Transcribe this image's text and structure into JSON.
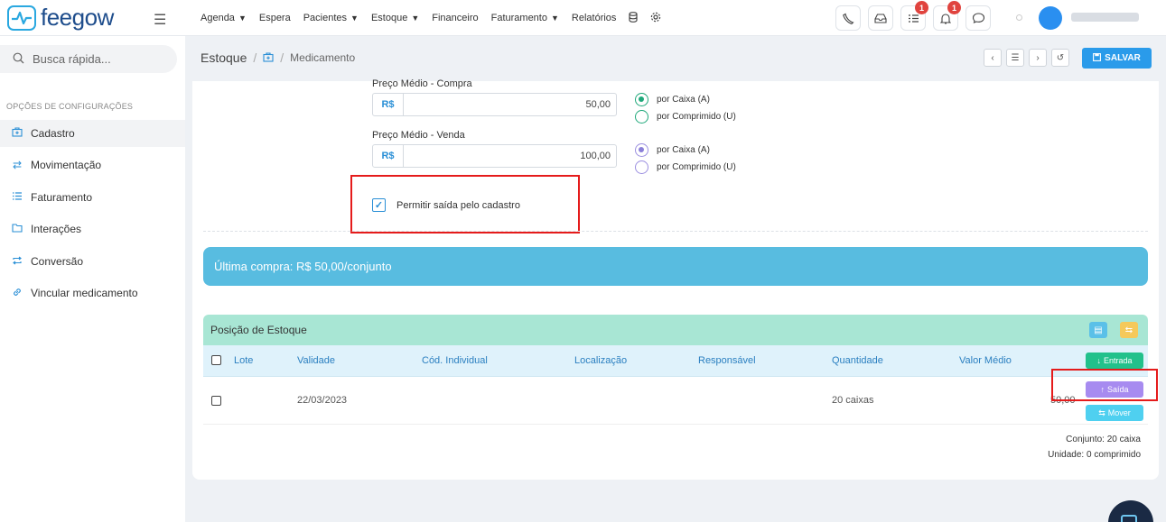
{
  "logo": {
    "text": "feegow"
  },
  "nav": {
    "items": [
      {
        "label": "Agenda",
        "dropdown": true
      },
      {
        "label": "Espera",
        "dropdown": false
      },
      {
        "label": "Pacientes",
        "dropdown": true
      },
      {
        "label": "Estoque",
        "dropdown": true
      },
      {
        "label": "Financeiro",
        "dropdown": false
      },
      {
        "label": "Faturamento",
        "dropdown": true
      },
      {
        "label": "Relatórios",
        "dropdown": false
      }
    ],
    "badges": {
      "tasks": "1",
      "notifications": "1"
    }
  },
  "sidebar": {
    "search_placeholder": "Busca rápida...",
    "section_title": "OPÇÕES DE CONFIGURAÇÕES",
    "items": [
      {
        "label": "Cadastro",
        "icon": "medkit-icon",
        "active": true
      },
      {
        "label": "Movimentação",
        "icon": "arrows-swap-icon",
        "active": false
      },
      {
        "label": "Faturamento",
        "icon": "list-icon",
        "active": false
      },
      {
        "label": "Interações",
        "icon": "folder-icon",
        "active": false
      },
      {
        "label": "Conversão",
        "icon": "repeat-icon",
        "active": false
      },
      {
        "label": "Vincular medicamento",
        "icon": "link-icon",
        "active": false
      }
    ]
  },
  "header": {
    "breadcrumb_root": "Estoque",
    "breadcrumb_sep": "/",
    "breadcrumb_sub": "Medicamento",
    "save_label": "SALVAR"
  },
  "form": {
    "compra": {
      "label": "Preço Médio - Compra",
      "prefix": "R$",
      "value": "50,00",
      "radio_a": "por Caixa (A)",
      "radio_u": "por Comprimido (U)",
      "selected": "A"
    },
    "venda": {
      "label": "Preço Médio - Venda",
      "prefix": "R$",
      "value": "100,00",
      "radio_a": "por Caixa (A)",
      "radio_u": "por Comprimido (U)",
      "selected": "A"
    },
    "permitir_saida": {
      "label": "Permitir saída pelo cadastro",
      "checked": true
    }
  },
  "alert": {
    "text": "Última compra: R$ 50,00/conjunto"
  },
  "stock": {
    "title": "Posição de Estoque",
    "columns": [
      "Lote",
      "Validade",
      "Cód. Individual",
      "Localização",
      "Responsável",
      "Quantidade",
      "Valor Médio"
    ],
    "rows": [
      {
        "lote": "",
        "validade": "22/03/2023",
        "cod": "",
        "localizacao": "",
        "responsavel": "",
        "quantidade": "20 caixas",
        "valor_medio": "50,00"
      }
    ],
    "actions": {
      "entrada": "Entrada",
      "saida": "Saída",
      "mover": "Mover"
    },
    "summary_conjunto": "Conjunto: 20 caixa",
    "summary_unidade": "Unidade: 0 comprimido"
  },
  "colors": {
    "brand_blue": "#2a9bea",
    "entrada_green": "#22c18b",
    "saida_purple": "#a78bf0",
    "mover_cyan": "#4fd0f0",
    "highlight_red": "#e51b1b"
  }
}
